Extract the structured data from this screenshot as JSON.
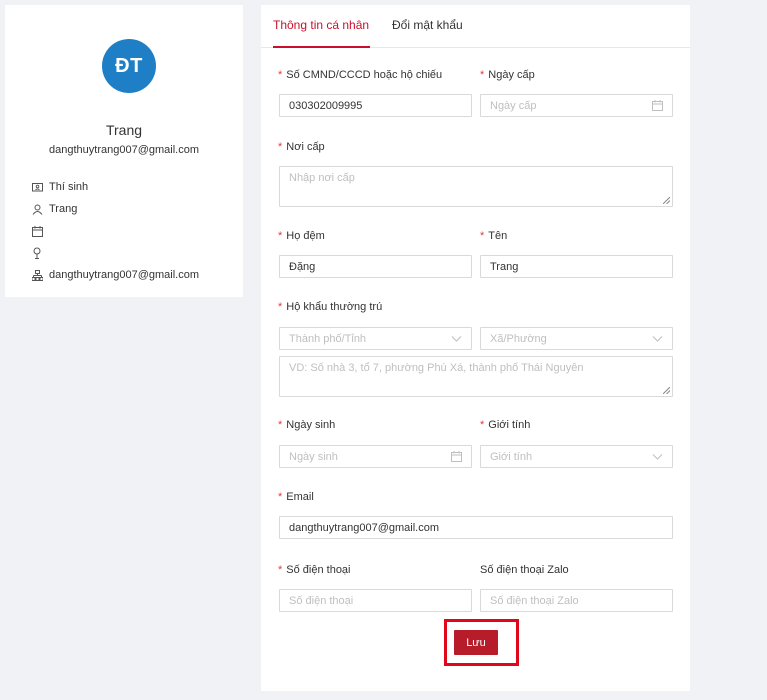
{
  "profile": {
    "initials": "ĐT",
    "name": "Trang",
    "email": "dangthuytrang007@gmail.com",
    "avatar_color": "#1e7fc7",
    "details": [
      {
        "icon": "id-card-icon",
        "text": "Thí sinh"
      },
      {
        "icon": "user-icon",
        "text": "Trang"
      },
      {
        "icon": "calendar-icon",
        "text": ""
      },
      {
        "icon": "location-pin-icon",
        "text": ""
      },
      {
        "icon": "sitemap-icon",
        "text": "dangthuytrang007@gmail.com"
      }
    ]
  },
  "tabs": [
    {
      "label": "Thông tin cá nhân",
      "active": true
    },
    {
      "label": "Đổi mật khẩu",
      "active": false
    }
  ],
  "form": {
    "id_number": {
      "label": "Số CMND/CCCD hoặc hộ chiếu",
      "value": "030302009995",
      "required": true
    },
    "issue_date": {
      "label": "Ngày cấp",
      "placeholder": "Ngày cấp",
      "required": true
    },
    "issue_place": {
      "label": "Nơi cấp",
      "placeholder": "Nhập nơi cấp",
      "required": true
    },
    "middle_name": {
      "label": "Họ đệm",
      "value": "Đặng",
      "required": true
    },
    "first_name": {
      "label": "Tên",
      "value": "Trang",
      "required": true
    },
    "residence": {
      "label": "Hộ khẩu thường trú",
      "required": true,
      "province_placeholder": "Thành phố/Tỉnh",
      "ward_placeholder": "Xã/Phường",
      "address_placeholder": "VD: Số nhà 3, tổ 7, phường Phú Xá, thành phố Thái Nguyên"
    },
    "birth_date": {
      "label": "Ngày sinh",
      "placeholder": "Ngày sinh",
      "required": true
    },
    "gender": {
      "label": "Giới tính",
      "placeholder": "Giới tính",
      "required": true
    },
    "email": {
      "label": "Email",
      "value": "dangthuytrang007@gmail.com",
      "required": true
    },
    "phone": {
      "label": "Số điện thoại",
      "placeholder": "Số điện thoại",
      "required": true
    },
    "zalo_phone": {
      "label": "Số điện thoại Zalo",
      "placeholder": "Số điện thoại Zalo",
      "required": false
    },
    "save_label": "Lưu"
  },
  "colors": {
    "accent": "#c8102e",
    "save_button": "#b71c2a",
    "highlight_box": "#e1071a",
    "required_star": "#e23b3b"
  }
}
